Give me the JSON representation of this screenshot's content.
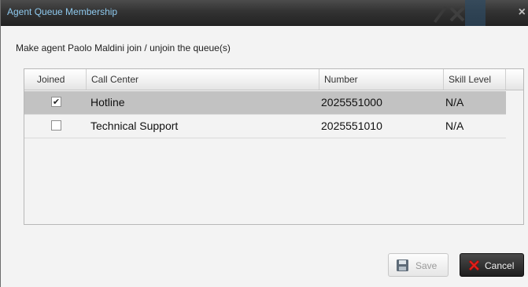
{
  "dialog": {
    "title": "Agent Queue Membership",
    "close_glyph": "×",
    "prompt": "Make agent Paolo Maldini join / unjoin the queue(s)"
  },
  "table": {
    "columns": [
      "Joined",
      "Call Center",
      "Number",
      "Skill Level"
    ],
    "rows": [
      {
        "joined": true,
        "call_center": "Hotline",
        "number": "2025551000",
        "skill_level": "N/A",
        "selected": true
      },
      {
        "joined": false,
        "call_center": "Technical Support",
        "number": "2025551010",
        "skill_level": "N/A",
        "selected": false
      }
    ]
  },
  "buttons": {
    "save_label": "Save",
    "cancel_label": "Cancel",
    "save_icon": "floppy-disk-icon",
    "cancel_icon": "red-x-icon"
  },
  "colors": {
    "title_text": "#8ec9ee",
    "selected_row": "#c2c2c2",
    "cancel_x": "#e0201b"
  }
}
